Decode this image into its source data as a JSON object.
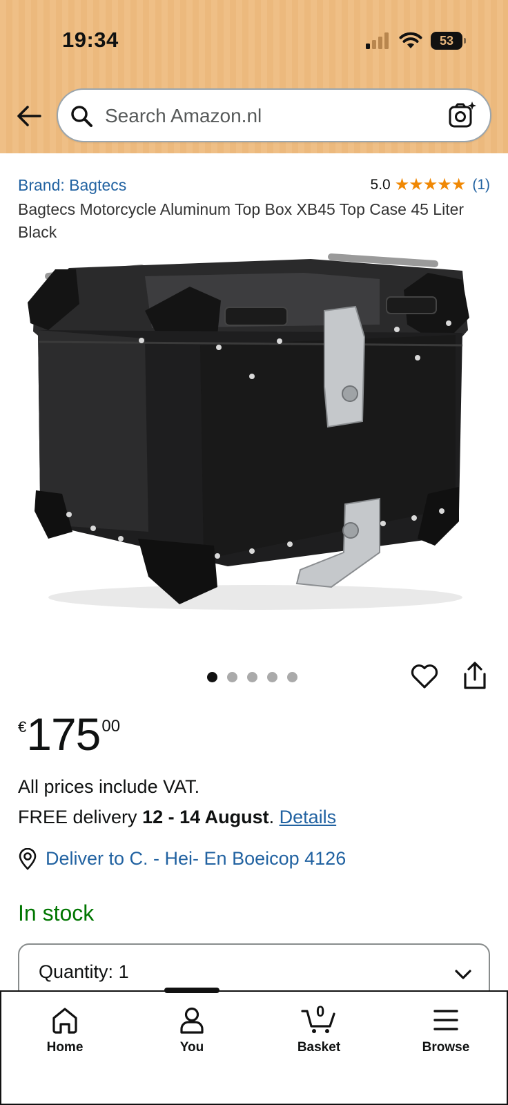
{
  "status_bar": {
    "time": "19:34",
    "battery": "53"
  },
  "search": {
    "placeholder": "Search Amazon.nl"
  },
  "product": {
    "brand": "Brand: Bagtecs",
    "rating_value": "5.0",
    "stars": "★★★★★",
    "rating_count": "(1)",
    "title": "Bagtecs Motorcycle Aluminum Top Box XB45 Top Case 45 Liter Black",
    "image_count": 5,
    "active_image": 1
  },
  "price": {
    "currency": "€",
    "whole": "175",
    "fraction": "00"
  },
  "delivery": {
    "vat_note": "All prices include VAT.",
    "prefix": "FREE delivery ",
    "dates": "12 - 14 August",
    "suffix": ". ",
    "details_link": "Details",
    "deliver_to": "Deliver to C. - Hei- En Boeicop 4126"
  },
  "stock": {
    "status": "In stock"
  },
  "quantity": {
    "label": "Quantity:",
    "value": "1"
  },
  "bottom_nav": {
    "home": "Home",
    "you": "You",
    "basket": "Basket",
    "basket_count": "0",
    "browse": "Browse"
  },
  "colors": {
    "header_bg": "#efbf86",
    "link": "#2162a1",
    "star": "#f08804",
    "in_stock": "#007600"
  }
}
